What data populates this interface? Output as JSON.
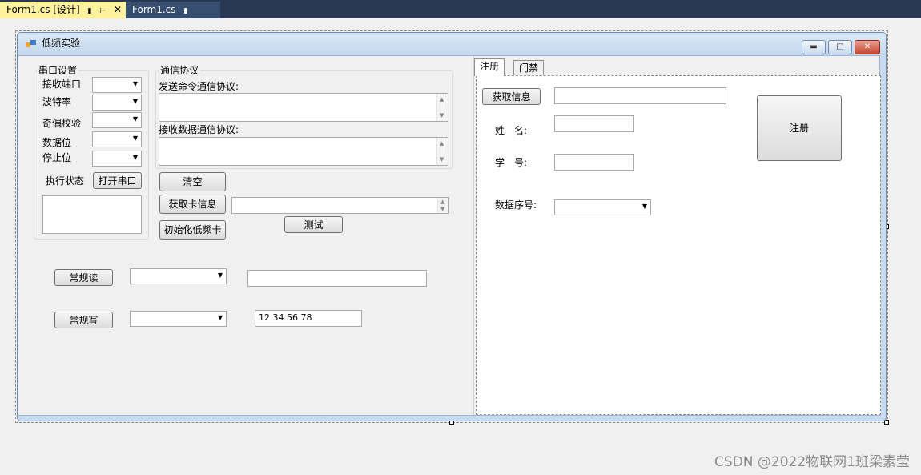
{
  "tabs": {
    "active": "Form1.cs [设计]",
    "inactive": "Form1.cs"
  },
  "form": {
    "title": "低频实验"
  },
  "serial": {
    "group": "串口设置",
    "port": "接收端口",
    "baud": "波特率",
    "parity": "奇偶校验",
    "databits": "数据位",
    "stopbits": "停止位",
    "status": "执行状态",
    "open_btn": "打开串口"
  },
  "protocol": {
    "group": "通信协议",
    "send_label": "发送命令通信协议:",
    "recv_label": "接收数据通信协议:"
  },
  "buttons": {
    "clear": "清空",
    "get_card": "获取卡信息",
    "init_card": "初始化低频卡",
    "test": "测试",
    "read": "常规读",
    "write": "常规写"
  },
  "write_value": "12 34 56 78",
  "right_tabs": {
    "register": "注册",
    "access": "门禁"
  },
  "register": {
    "get_info": "获取信息",
    "name": "姓　名:",
    "student_id": "学　号:",
    "data_seq": "数据序号:",
    "register_btn": "注册"
  },
  "watermark": "CSDN @2022物联网1班梁素莹"
}
